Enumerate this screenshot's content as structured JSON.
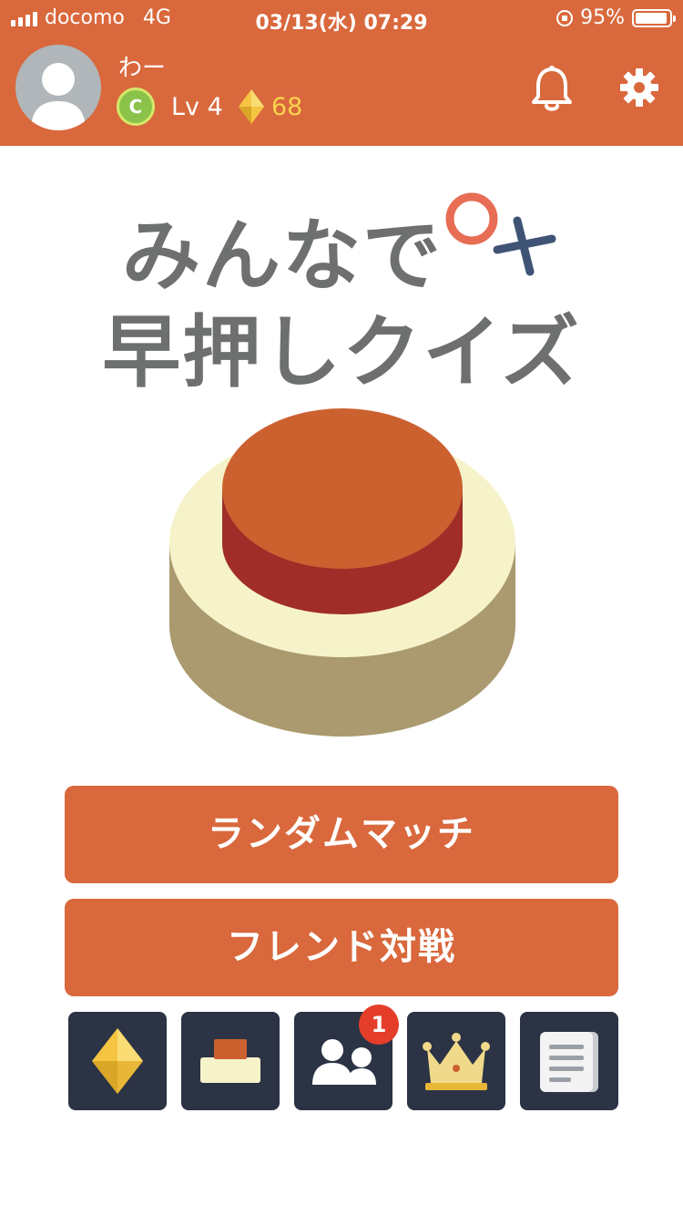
{
  "status_bar": {
    "carrier": "docomo",
    "network": "4G",
    "datetime": "03/13(水) 07:29",
    "battery_percent": "95%",
    "battery_level": 0.95
  },
  "profile": {
    "name": "わー",
    "rank": "C",
    "level": "Lv 4",
    "gems": "68"
  },
  "title": {
    "line1": "みんなで",
    "line2": "早押しクイズ"
  },
  "buttons": {
    "random_match": "ランダムマッチ",
    "friend_battle": "フレンド対戦"
  },
  "tiles": [
    {
      "icon": "gem-icon"
    },
    {
      "icon": "buzzer-icon"
    },
    {
      "icon": "friends-icon",
      "badge": "1"
    },
    {
      "icon": "crown-icon"
    },
    {
      "icon": "document-icon"
    }
  ],
  "colors": {
    "primary": "#d9683c",
    "tile_bg": "#2b3345",
    "title_text": "#6d706f",
    "gem": "#f9d24f",
    "badge": "#e43e2b"
  }
}
